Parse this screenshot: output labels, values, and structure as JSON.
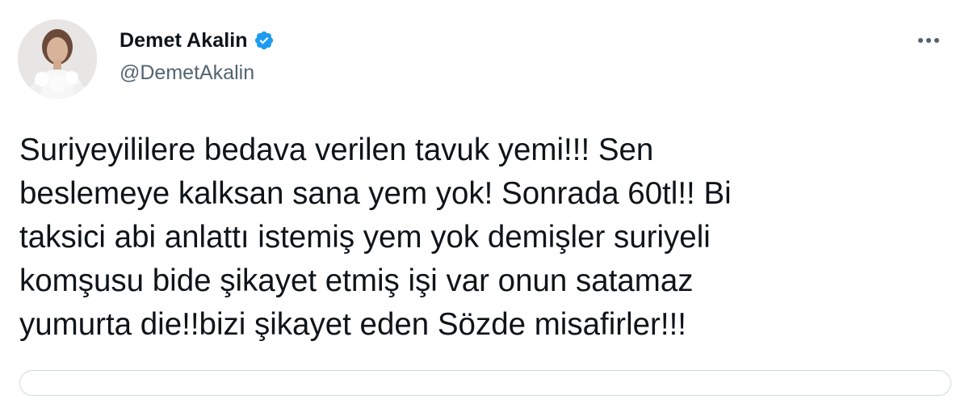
{
  "author": {
    "display_name": "Demet Akalin",
    "handle": "@DemetAkalin",
    "verified": true,
    "avatar_icon": "profile-photo"
  },
  "menu": {
    "icon": "more-options-icon"
  },
  "tweet": {
    "text": "Suriyeyililere bedava verilen tavuk yemi!!! Sen\nbeslemeye kalksan sana yem yok! Sonrada 60tl!! Bi\ntaksici abi anlattı istemiş yem yok demişler suriyeli\nkomşusu bide şikayet etmiş işi var onun satamaz\nyumurta die!!bizi şikayet eden Sözde misafirler!!!"
  },
  "colors": {
    "text": "#0f1419",
    "secondary": "#536471",
    "verified_badge": "#1d9bf0",
    "border": "#cfd9de"
  }
}
